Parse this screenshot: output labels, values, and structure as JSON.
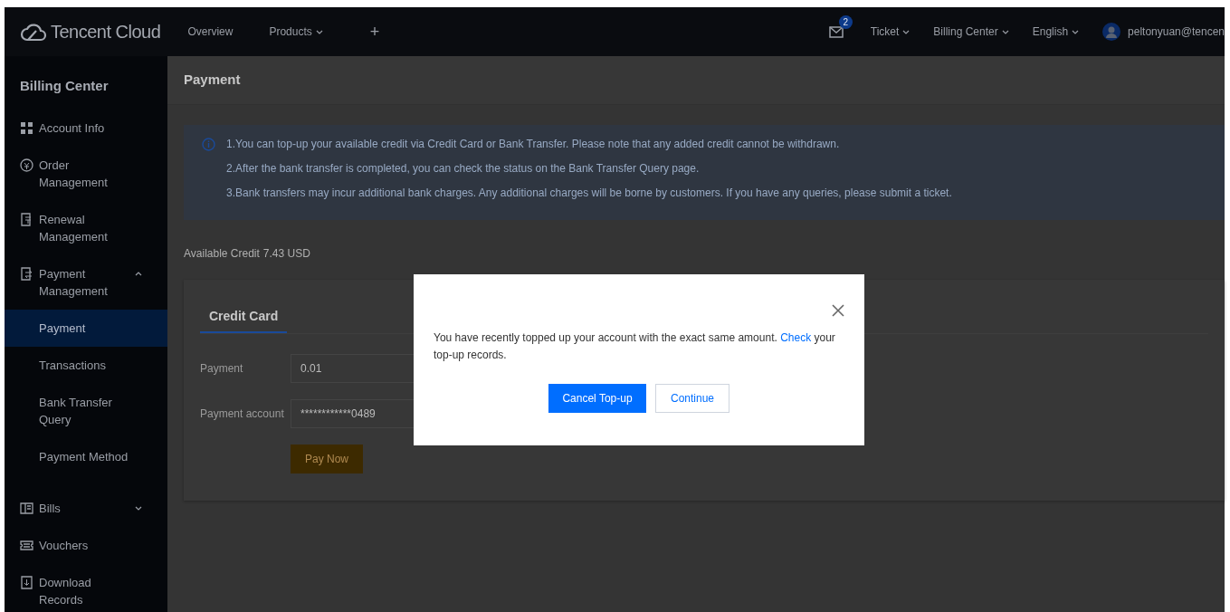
{
  "top_nav": {
    "logo": "Tencent Cloud",
    "links": [
      {
        "label": "Overview",
        "dropdown": false
      },
      {
        "label": "Products",
        "dropdown": true
      }
    ],
    "add_label": "+",
    "mail_badge": "2",
    "right_menus": [
      {
        "label": "Ticket"
      },
      {
        "label": "Billing Center"
      },
      {
        "label": "English"
      }
    ],
    "user": "peltonyuan@tencen"
  },
  "sidebar": {
    "title": "Billing Center",
    "items": [
      {
        "label": "Account Info",
        "selected": false
      },
      {
        "label": "Order Management",
        "selected": false
      },
      {
        "label": "Renewal Management",
        "selected": false
      },
      {
        "label": "Payment Management",
        "selected": false,
        "expanded": true,
        "children": [
          {
            "label": "Payment",
            "selected": true
          },
          {
            "label": "Transactions",
            "selected": false
          },
          {
            "label": "Bank Transfer Query",
            "selected": false
          },
          {
            "label": "Payment Method",
            "selected": false
          }
        ]
      },
      {
        "label": "Bills",
        "selected": false,
        "expanded": false
      },
      {
        "label": "Vouchers",
        "selected": false
      },
      {
        "label": "Download Records",
        "selected": false
      }
    ]
  },
  "page": {
    "title": "Payment",
    "notice": [
      "1.You can top-up your available credit via Credit Card or Bank Transfer. Please note that any added credit cannot be withdrawn.",
      "2.After the bank transfer is completed, you can check the status on the Bank Transfer Query page.",
      "3.Bank transfers may incur additional bank charges. Any additional charges will be borne by customers. If you have any queries, please submit a ticket."
    ],
    "credit_label": "Available Credit",
    "credit_value": "7.43 USD",
    "tabs": [
      {
        "label": "Credit Card",
        "selected": true
      }
    ],
    "form": [
      {
        "label": "Payment",
        "value": "0.01"
      },
      {
        "label": "Payment account",
        "value": "************0489"
      }
    ],
    "submit": "Pay Now"
  },
  "dialog": {
    "message_before": "You have recently topped up your account with the exact same amount.",
    "link": "Check",
    "message_after": "your top-up records.",
    "primary": "Cancel Top-up",
    "secondary": "Continue"
  }
}
